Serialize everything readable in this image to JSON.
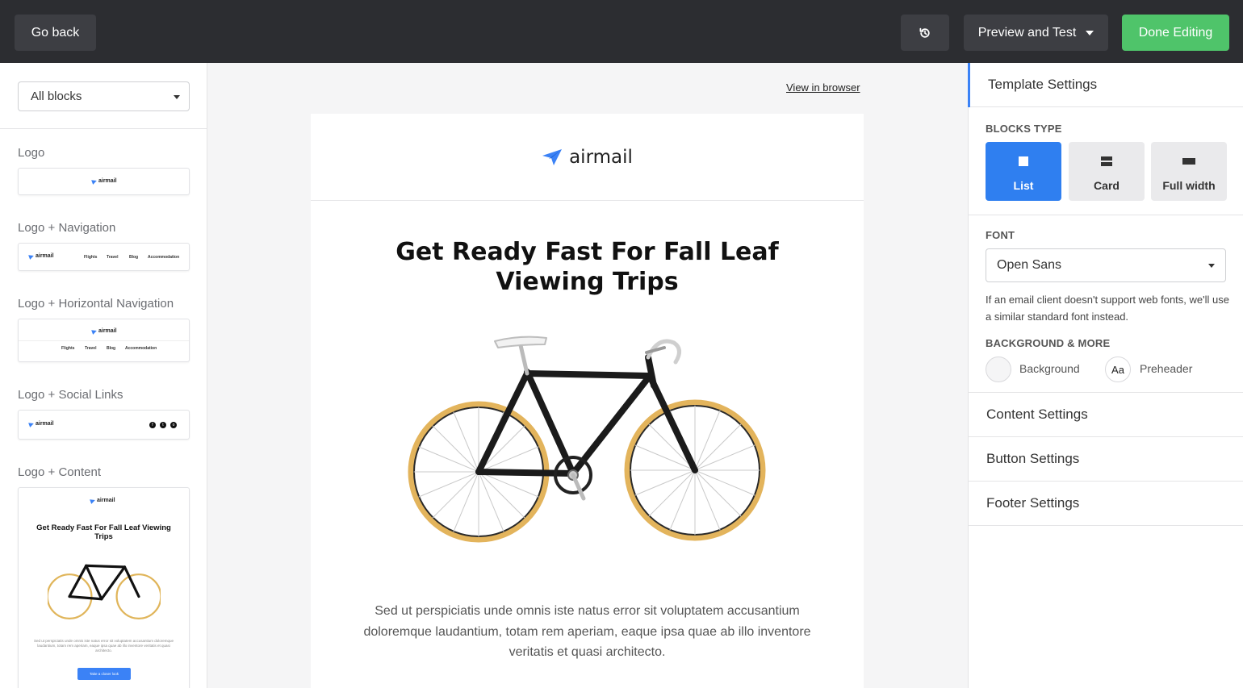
{
  "topbar": {
    "go_back": "Go back",
    "history_icon": "history-icon",
    "preview_label": "Preview and Test",
    "done_label": "Done Editing",
    "colors": {
      "bar": "#2c2d31",
      "button": "#3d3e43",
      "done": "#4fc46a"
    }
  },
  "sidebar": {
    "filter_value": "All blocks",
    "blocks": [
      {
        "label": "Logo"
      },
      {
        "label": "Logo + Navigation",
        "nav": [
          "Flights",
          "Travel",
          "Blog",
          "Accommodation"
        ]
      },
      {
        "label": "Logo + Horizontal Navigation",
        "nav": [
          "Flights",
          "Travel",
          "Blog",
          "Accommodation"
        ]
      },
      {
        "label": "Logo + Social Links"
      },
      {
        "label": "Logo + Content",
        "title": "Get Ready Fast For Fall Leaf Viewing Trips",
        "text": "Sed ut perspiciatis unde omnis iste natus error sit voluptatem accusantium doloremque laudantium, totam rem aperiam, eaque ipsa quae ab illo inventore veritatis et quasi architecto.",
        "button": "Take a closer look"
      }
    ],
    "mini_brand": "airmail"
  },
  "canvas": {
    "view_in_browser": "View in browser",
    "brand": "airmail",
    "title": "Get Ready Fast For Fall Leaf Viewing Trips",
    "body": "Sed ut perspiciatis unde omnis iste natus error sit voluptatem accusantium doloremque laudantium, totam rem aperiam, eaque ipsa quae ab illo inventore veritatis et quasi architecto.",
    "accent": "#3b82f6"
  },
  "panel": {
    "template_settings": "Template Settings",
    "blocks_type_title": "BLOCKS TYPE",
    "block_types": [
      {
        "label": "List",
        "active": true
      },
      {
        "label": "Card",
        "active": false
      },
      {
        "label": "Full width",
        "active": false
      }
    ],
    "font_title": "FONT",
    "font_value": "Open Sans",
    "font_help": "If an email client doesn't support web fonts, we'll use a similar standard font instead.",
    "bg_title": "BACKGROUND & MORE",
    "background_label": "Background",
    "preheader_label": "Preheader",
    "preheader_swatch": "Aa",
    "content_settings": "Content Settings",
    "button_settings": "Button Settings",
    "footer_settings": "Footer Settings",
    "accent": "#2f7ff0"
  }
}
